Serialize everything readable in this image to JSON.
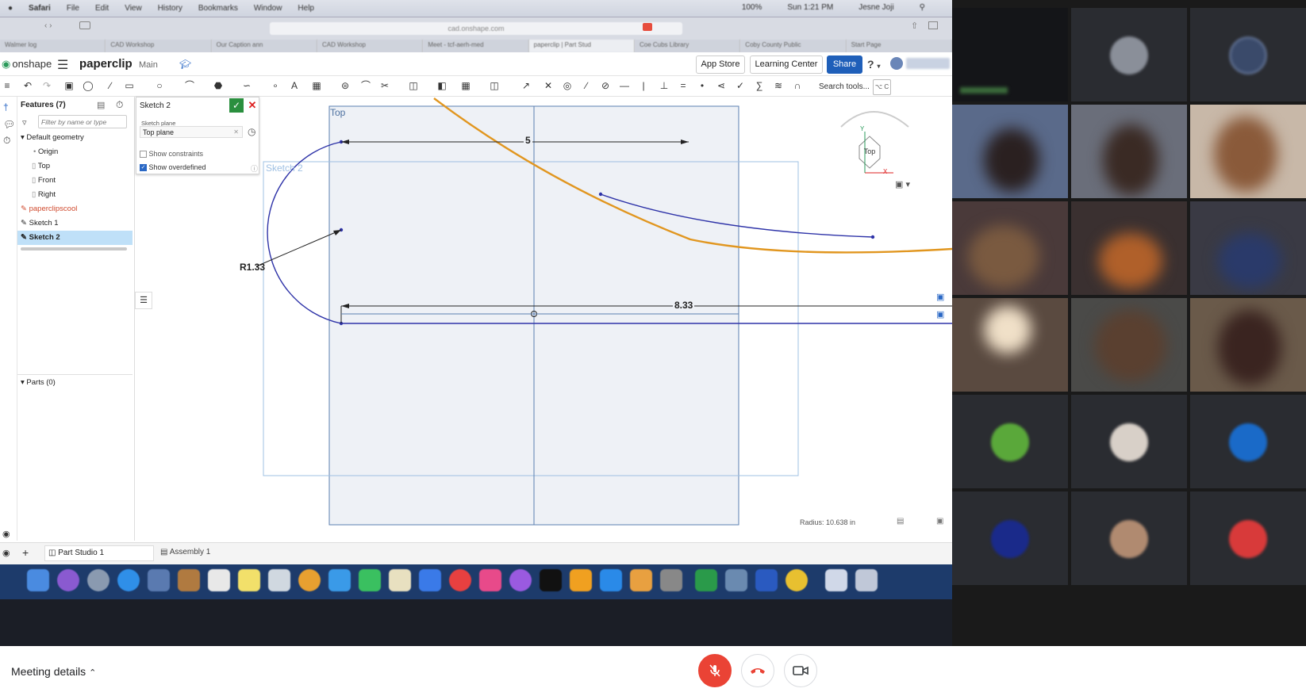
{
  "mac": {
    "apple": "",
    "menu": [
      "Safari",
      "File",
      "Edit",
      "View",
      "History",
      "Bookmarks",
      "Window",
      "Help"
    ],
    "status": [
      "100%",
      "Sun 1:21 PM",
      "Jesne Joji"
    ]
  },
  "browser": {
    "url": "cad.onshape.com",
    "tabs": [
      "Walmer log",
      "CAD Workshop",
      "Our Caption ann",
      "CAD Workshop",
      "Meet - tcf-aerh-med",
      "paperclip | Part Stud",
      "Coe Cubs Library",
      "Coby County Public",
      "Start Page"
    ]
  },
  "onshape": {
    "logo": "onshape",
    "doc_title": "paperclip",
    "branch": "Main",
    "header_buttons": {
      "app_store": "App Store",
      "learning_center": "Learning Center",
      "share": "Share"
    },
    "help": "?",
    "search_tools": "Search tools...",
    "search_shortcut": "⌥ C",
    "features": {
      "title": "Features (7)",
      "filter_placeholder": "Filter by name or type",
      "default_geometry": "Default geometry",
      "origin": "Origin",
      "planes": [
        "Top",
        "Front",
        "Right"
      ],
      "items": [
        "paperclipscool",
        "Sketch 1",
        "Sketch 2"
      ],
      "parts": "Parts (0)"
    },
    "sketch_dialog": {
      "title": "Sketch 2",
      "plane_label": "Sketch plane",
      "plane_value": "Top plane",
      "show_constraints": "Show constraints",
      "show_overdefined": "Show overdefined"
    },
    "canvas": {
      "plane_label": "Top",
      "sketch_label": "Sketch 2",
      "dim_top": "5",
      "dim_bottom": "8.33",
      "radius": "R1.33",
      "view_cube": "Top",
      "axis_y": "Y",
      "axis_x": "X",
      "status": "Radius: 10.638 in"
    },
    "bottom_tabs": {
      "part_studio": "Part Studio 1",
      "assembly": "Assembly 1",
      "add": "+"
    }
  },
  "meet": {
    "meeting_details": "Meeting details",
    "colors": {
      "mic_off": "#ea4335",
      "end_call": "#ea4335",
      "accent": "#1f5fb9"
    }
  }
}
